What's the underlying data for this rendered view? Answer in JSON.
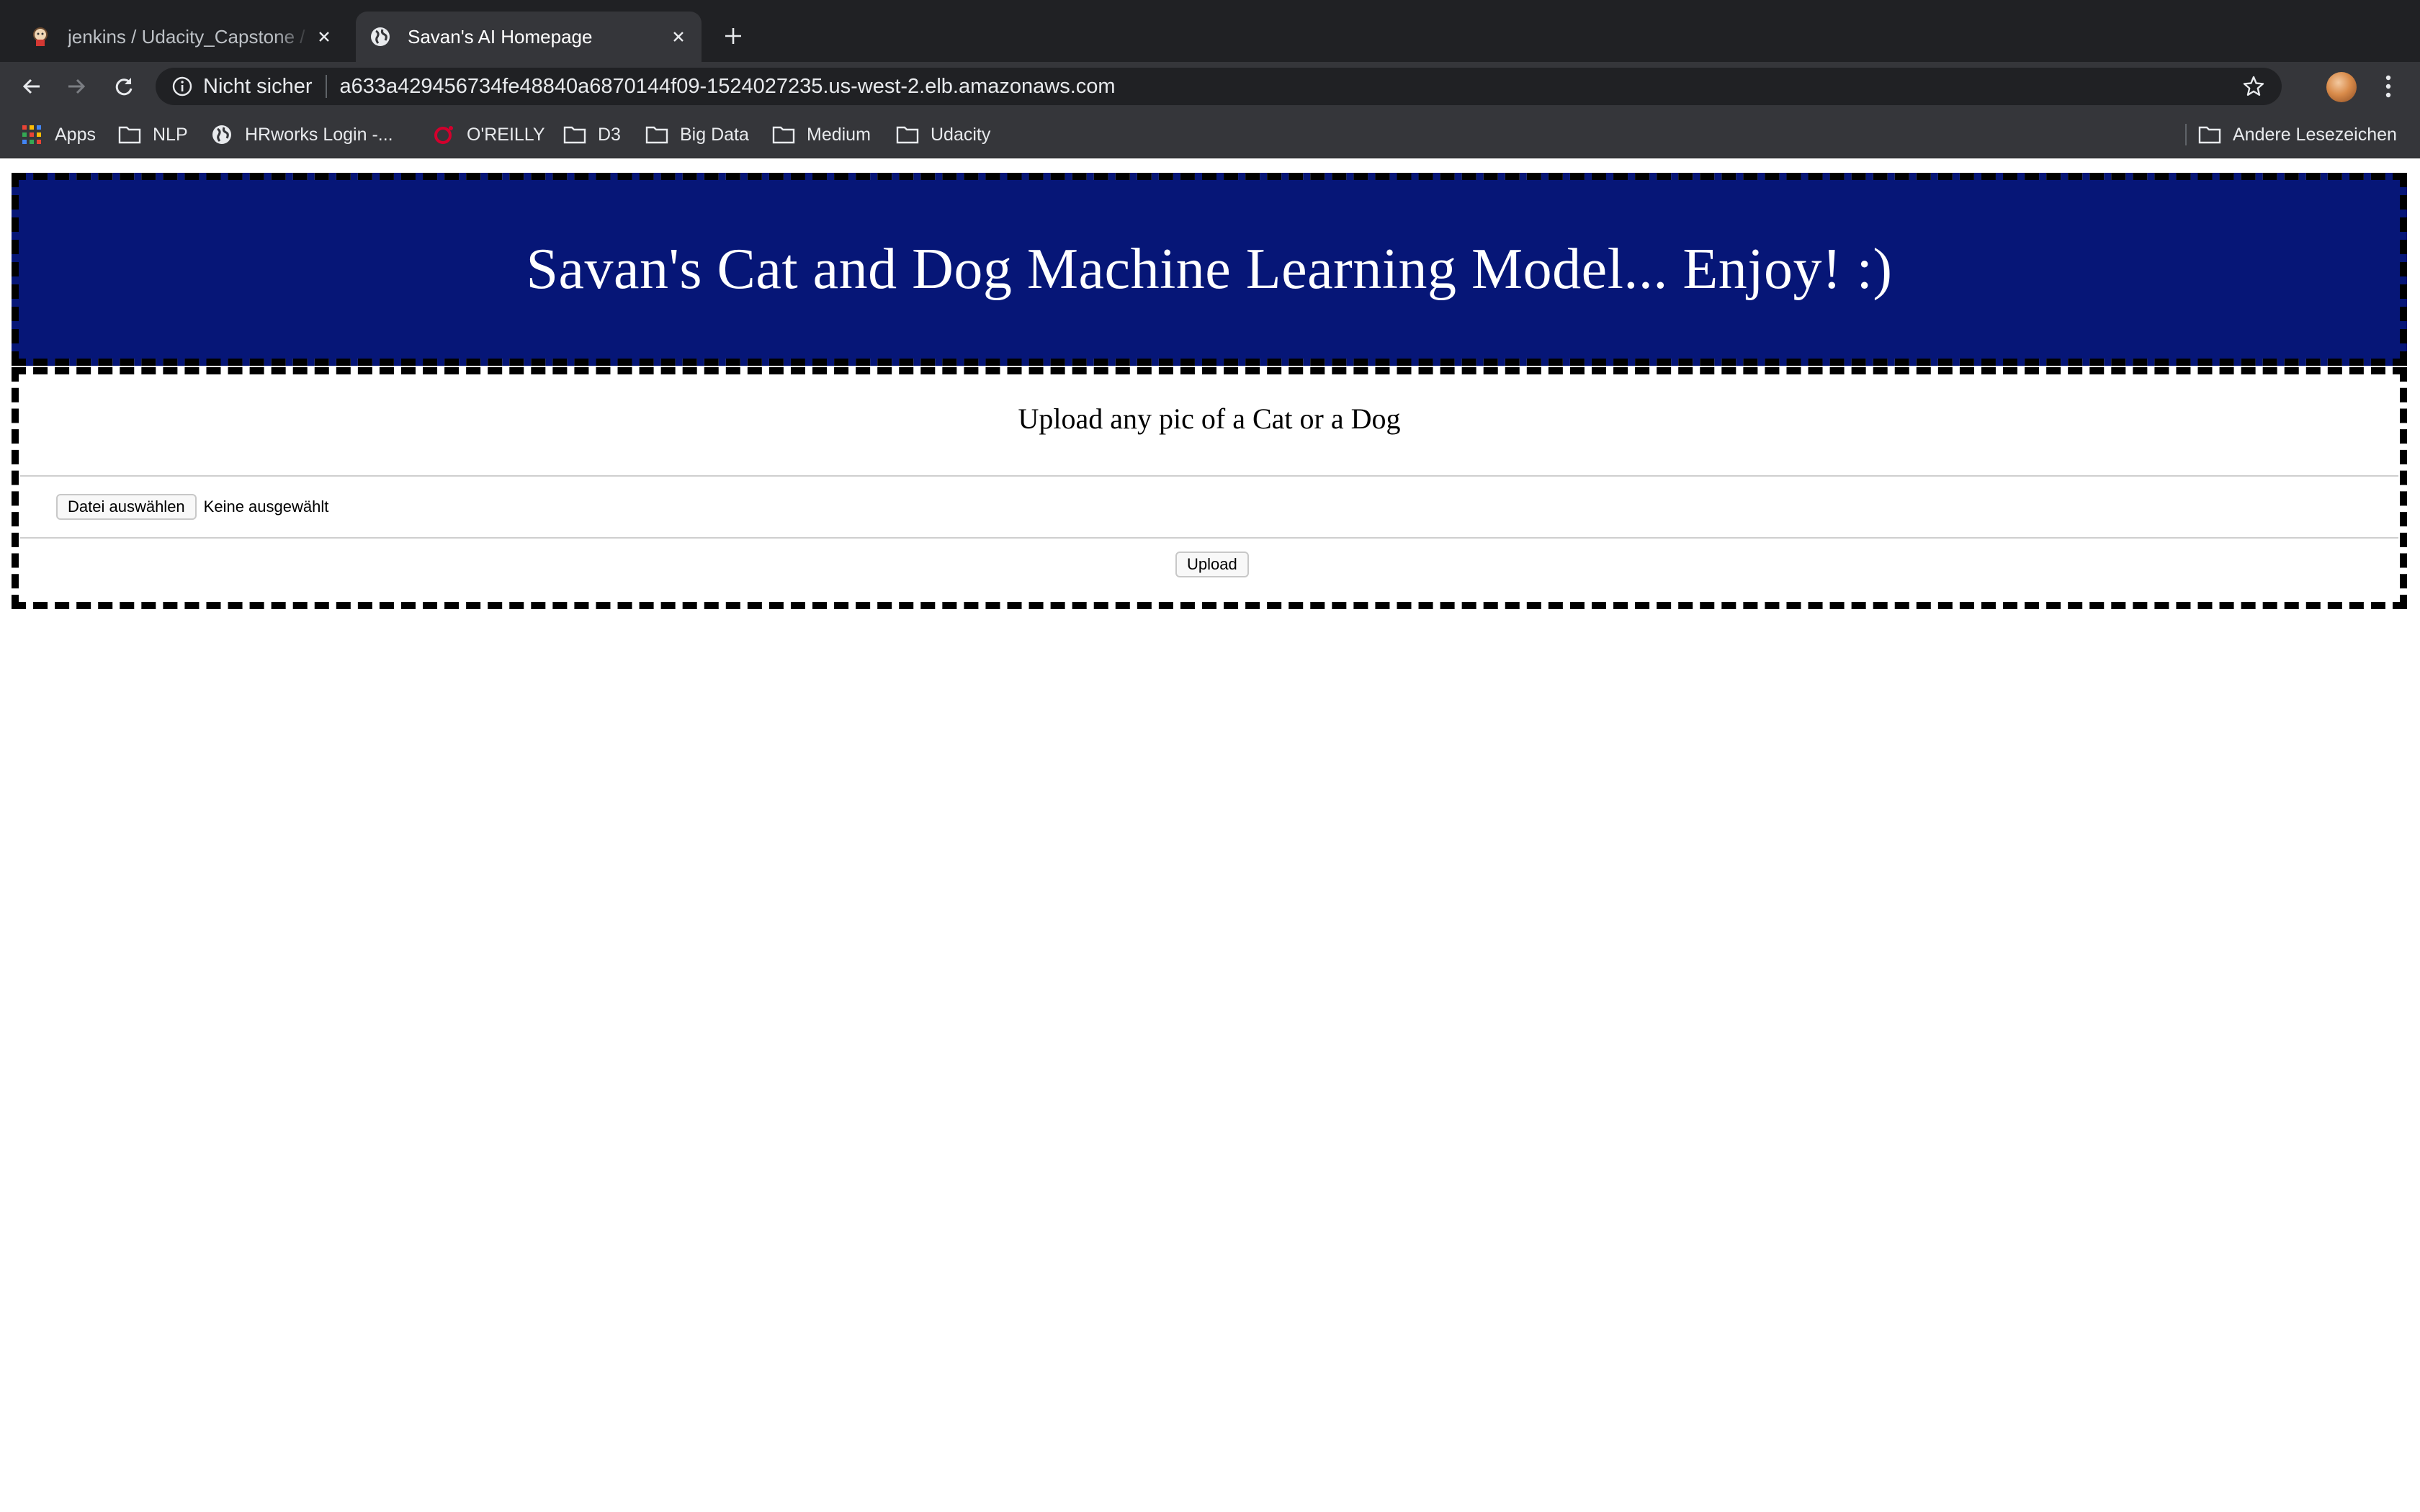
{
  "browser": {
    "tabs": [
      {
        "title": "jenkins / Udacity_Capstone / master",
        "active": false,
        "icon": "jenkins-icon"
      },
      {
        "title": "Savan's AI Homepage",
        "active": true,
        "icon": "globe-icon"
      }
    ],
    "address_bar": {
      "security_label": "Nicht sicher",
      "url": "a633a429456734fe48840a6870144f09-1524027235.us-west-2.elb.amazonaws.com"
    },
    "bookmarks": [
      {
        "label": "Apps",
        "icon": "apps-grid-icon"
      },
      {
        "label": "NLP",
        "icon": "folder-icon"
      },
      {
        "label": "HRworks Login -...",
        "icon": "globe-icon"
      },
      {
        "label": "O'REILLY",
        "icon": "oreilly-icon"
      },
      {
        "label": "D3",
        "icon": "folder-icon"
      },
      {
        "label": "Big Data",
        "icon": "folder-icon"
      },
      {
        "label": "Medium",
        "icon": "folder-icon"
      },
      {
        "label": "Udacity",
        "icon": "folder-icon"
      }
    ],
    "other_bookmarks": "Andere Lesezeichen"
  },
  "page": {
    "banner_title": "Savan's Cat and Dog Machine Learning Model... Enjoy! :)",
    "upload_heading": "Upload any pic of a Cat or a Dog",
    "file_button_label": "Datei auswählen",
    "file_status": "Keine ausgewählt",
    "upload_button_label": "Upload"
  },
  "colors": {
    "banner_background": "#061677",
    "chrome_dark": "#202124",
    "chrome_toolbar": "#35363a"
  }
}
